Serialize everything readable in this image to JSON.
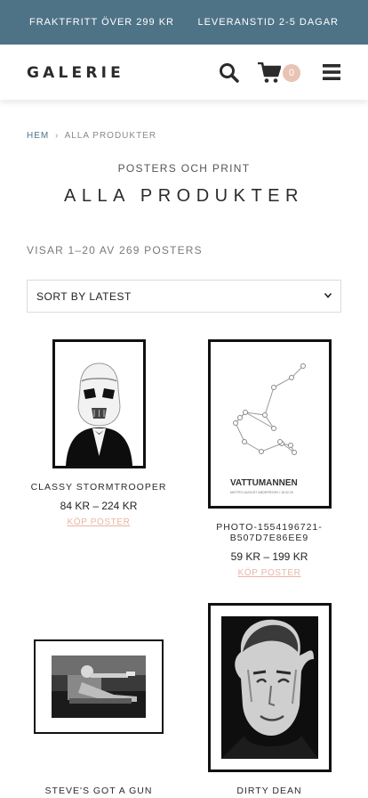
{
  "topbar": {
    "left_text": "FRAKTFRITT ÖVER 299 KR",
    "right_text": "LEVERANSTID 2-5 DAGAR",
    "bg_color": "#4f7386"
  },
  "header": {
    "logo": "GALERIE",
    "cart_count": "0",
    "icons": [
      "search-icon",
      "cart-icon",
      "menu-icon"
    ],
    "badge_color": "#e9c3b3"
  },
  "breadcrumb": {
    "home": "HEM",
    "separator": "›",
    "current": "ALLA PRODUKTER"
  },
  "category": {
    "subtitle": "POSTERS OCH PRINT",
    "title": "ALLA PRODUKTER",
    "result_count": "VISAR 1–20 AV 269 POSTERS"
  },
  "sort": {
    "selected": "SORT BY LATEST"
  },
  "products": [
    {
      "name": "CLASSY STORMTROOPER",
      "price": "84 KR – 224 KR",
      "buy": "KÖP POSTER"
    },
    {
      "name_line1": "PHOTO-1554196721-",
      "name_line2": "B507D7E86EE9",
      "price": "59 KR – 199 KR",
      "buy": "KÖP POSTER",
      "poster_text": "VATTUMANNEN",
      "poster_small": "MATTEO AUGUST ANDERSSON / 18.02.20"
    },
    {
      "name": "STEVE'S GOT A GUN"
    },
    {
      "name": "DIRTY DEAN"
    }
  ]
}
